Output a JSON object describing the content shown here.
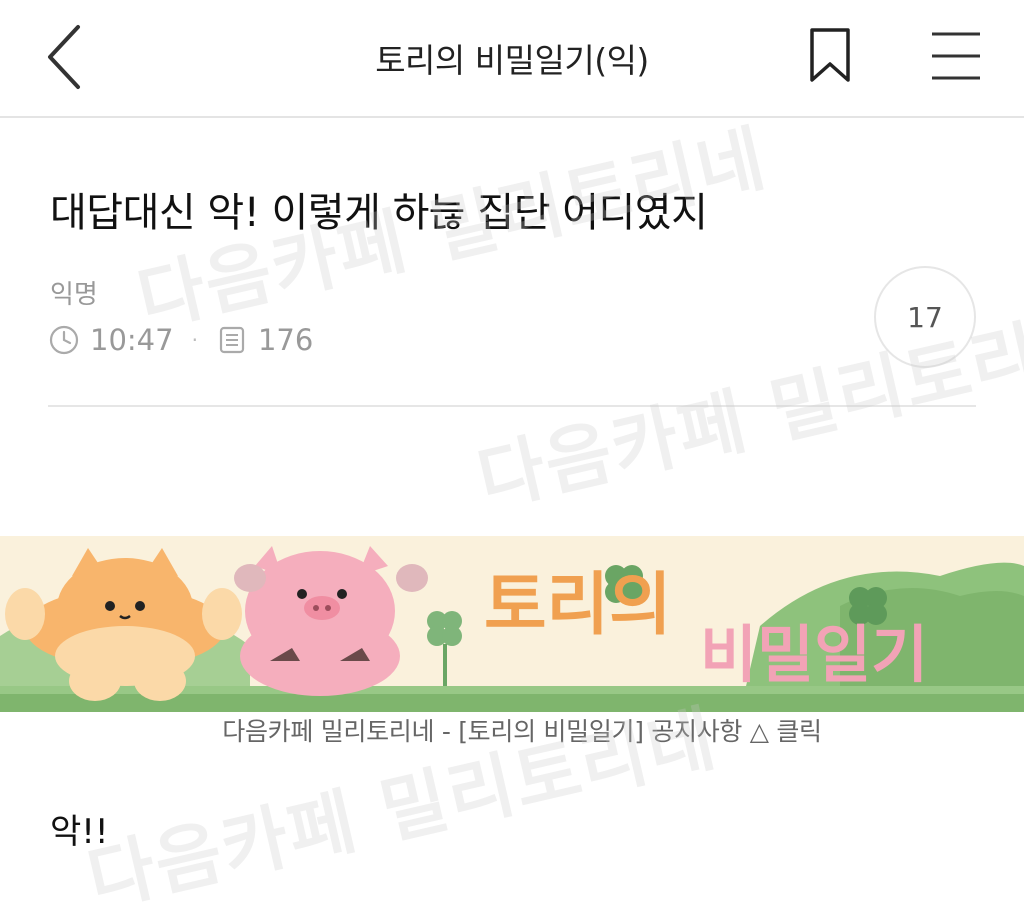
{
  "topbar": {
    "title": "토리의 비밀일기(익)",
    "back_icon": "chevron-left-icon",
    "bookmark_icon": "bookmark-icon",
    "menu_icon": "hamburger-menu-icon"
  },
  "post": {
    "title": "대답대신 악! 이렇게 하늖 집단 어디였지",
    "author": "익명",
    "time": "10:47",
    "views": "176",
    "comments": "17",
    "body": "악!!"
  },
  "banner": {
    "title_part1": "토리의",
    "title_part2": "비밀일기",
    "caption": "다음카페 밀리토리네 - [토리의 비밀일기] 공지사항 △ 클릭"
  },
  "watermark": {
    "text": "다음카페 밀리토리네"
  },
  "colors": {
    "banner_bg": "#faf1dc",
    "grass": "#8cc07a",
    "orange_cat": "#f6a85a",
    "pink_pig": "#f4a6b6",
    "clover": "#7fb57a"
  }
}
